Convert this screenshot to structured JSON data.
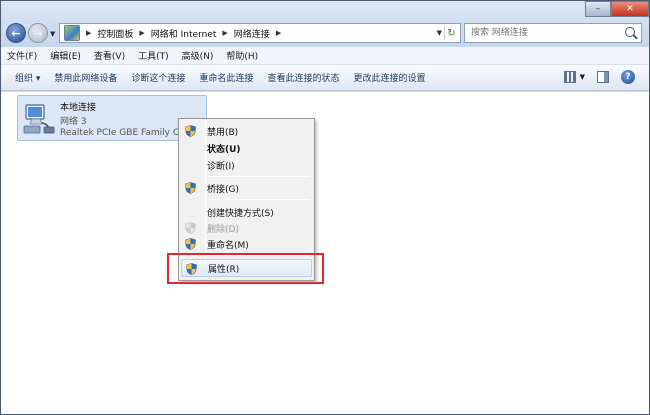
{
  "address": {
    "crumbs": [
      "控制面板",
      "网络和 Internet",
      "网络连接"
    ]
  },
  "search": {
    "placeholder": "搜索 网络连接"
  },
  "menubar": {
    "items": [
      "文件(F)",
      "编辑(E)",
      "查看(V)",
      "工具(T)",
      "高级(N)",
      "帮助(H)"
    ]
  },
  "toolbar": {
    "organize": "组织 ▾",
    "items": [
      "禁用此网络设备",
      "诊断这个连接",
      "重命名此连接",
      "查看此连接的状态",
      "更改此连接的设置"
    ]
  },
  "connection": {
    "name": "本地连接",
    "network": "网络  3",
    "device": "Realtek PCIe GBE Family Co"
  },
  "context_menu": {
    "disable": "禁用(B)",
    "status": "状态(U)",
    "diagnose": "诊断(I)",
    "bridge": "桥接(G)",
    "shortcut": "创建快捷方式(S)",
    "delete": "删除(D)",
    "rename": "重命名(M)",
    "properties": "属性(R)"
  },
  "colors": {
    "highlight": "#e3272e",
    "selection": "#dbe7f6",
    "window_chrome": "#cfdcec"
  },
  "icons": {
    "back": "back-arrow-icon",
    "forward": "forward-arrow-icon",
    "search": "search-icon",
    "shield": "uac-shield-icon",
    "network": "network-adapter-icon",
    "help": "help-icon"
  }
}
